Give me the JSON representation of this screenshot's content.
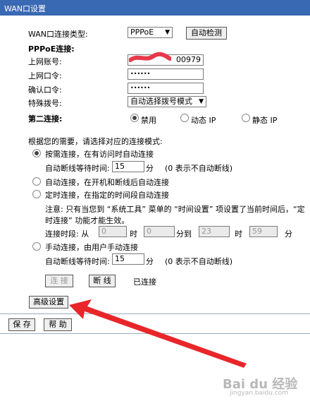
{
  "title": "WAN口设置",
  "wan_type": {
    "label": "WAN口连接类型:",
    "value": "PPPoE",
    "detect_button": "自动检测"
  },
  "pppoe": {
    "section_label": "PPPoE连接:",
    "account_label": "上网账号:",
    "account_value": "00979",
    "password_label": "上网口令:",
    "password_value": "••••••",
    "confirm_label": "确认口令:",
    "confirm_value": "••••••",
    "dial_label": "特殊拨号:",
    "dial_value": "自动选择拨号模式"
  },
  "second_conn": {
    "label": "第二连接:",
    "opt_disabled": "禁用",
    "opt_dynamic": "动态 IP",
    "opt_static": "静态 IP"
  },
  "mode_prompt": "根据您的需要，请选择对应的连接模式:",
  "mode1": {
    "label": "按需连接，在有访问时自动连接",
    "idle_label": "自动断线等待时间:",
    "idle_value": "15",
    "idle_unit": "分",
    "idle_note": "(0 表示不自动断线)"
  },
  "mode2": {
    "label": "自动连接，在开机和断线后自动连接"
  },
  "mode3": {
    "label": "定时连接，在指定的时间段自动连接",
    "note1": "注意: 只有当您到 “系统工具” 菜单的 “时间设置” 项设置了当前时间后，“定",
    "note2": "时连接” 功能才能生效。",
    "period_label": "连接时段: 从",
    "from_h": "0",
    "hour1": "时",
    "from_m": "0",
    "to": "分到",
    "to_h": "23",
    "hour2": "时",
    "to_m": "59",
    "min": "分"
  },
  "mode4": {
    "label": "手动连接，由用户手动连接",
    "idle_label": "自动断线等待时间:",
    "idle_value": "15",
    "idle_unit": "分",
    "idle_note": "(0 表示不自动断线)"
  },
  "actions": {
    "connect": "连 接",
    "disconnect": "断 线",
    "status": "已连接"
  },
  "advanced_button": "高级设置",
  "save_button": "保 存",
  "help_button": "帮 助",
  "watermark": {
    "brand": "Bai du 经验",
    "url": "jingyan.baidu.com"
  },
  "colors": {
    "titlebar": "#3a69b3",
    "arrow": "#e8262a",
    "redact": "#e8384a"
  }
}
